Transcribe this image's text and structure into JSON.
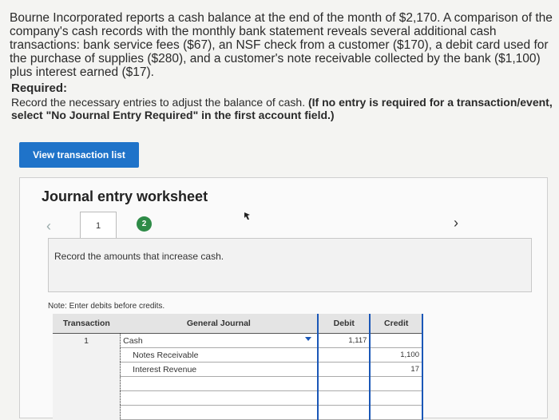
{
  "problem": {
    "text": "Bourne Incorporated reports a cash balance at the end of the month of $2,170. A comparison of the company's cash records with the monthly bank statement reveals several additional cash transactions: bank service fees ($67), an NSF check from a customer ($170), a debit card used for the purchase of supplies ($280), and a customer's note receivable collected by the bank ($1,100) plus interest earned ($17)."
  },
  "required": {
    "heading": "Required:",
    "text": "Record the necessary entries to adjust the balance of cash.",
    "bold_text": "(If no entry is required for a transaction/event, select \"No Journal Entry Required\" in the first account field.)"
  },
  "view_button_label": "View transaction list",
  "worksheet": {
    "title": "Journal entry worksheet",
    "tabs": [
      "1",
      "2"
    ],
    "instruction": "Record the amounts that increase cash.",
    "note": "Note: Enter debits before credits."
  },
  "table": {
    "headers": {
      "transaction": "Transaction",
      "general_journal": "General Journal",
      "debit": "Debit",
      "credit": "Credit"
    },
    "rows": [
      {
        "txn": "1",
        "account": "Cash",
        "debit": "1,117",
        "credit": ""
      },
      {
        "txn": "",
        "account": "Notes Receivable",
        "debit": "",
        "credit": "1,100"
      },
      {
        "txn": "",
        "account": "Interest Revenue",
        "debit": "",
        "credit": "17"
      },
      {
        "txn": "",
        "account": "",
        "debit": "",
        "credit": ""
      },
      {
        "txn": "",
        "account": "",
        "debit": "",
        "credit": ""
      },
      {
        "txn": "",
        "account": "",
        "debit": "",
        "credit": ""
      }
    ]
  },
  "colors": {
    "primary_button": "#1f73c9",
    "active_tab": "#2e8b47",
    "accent_border": "#1a57b7"
  },
  "icons": {
    "prev": "chevron-left-icon",
    "next": "chevron-right-icon",
    "cursor": "mouse-cursor-icon",
    "dropdown": "dropdown-arrow-icon"
  }
}
